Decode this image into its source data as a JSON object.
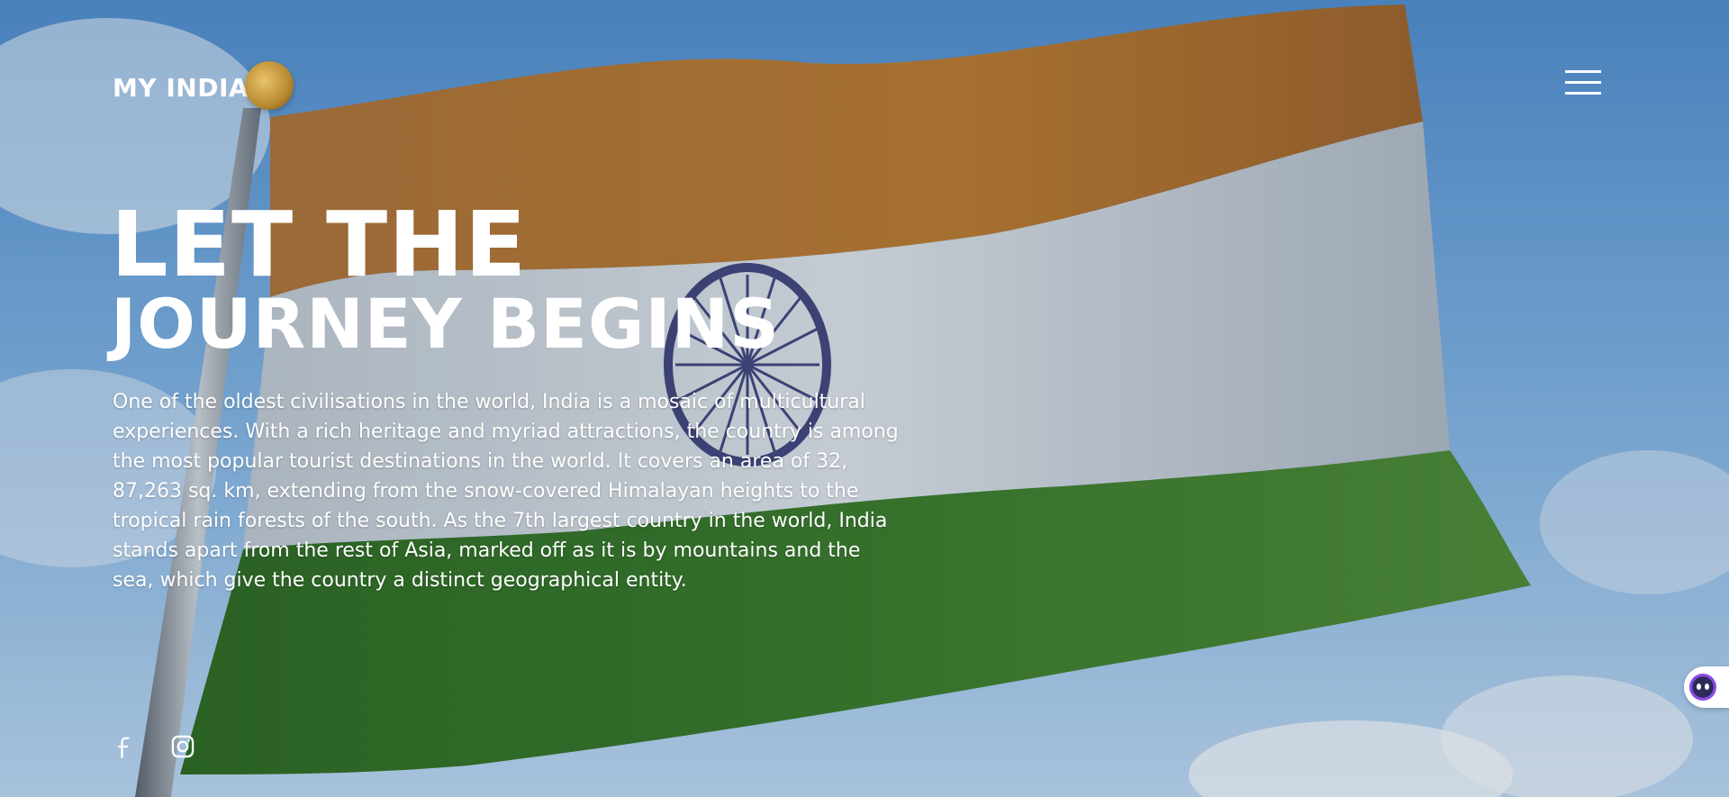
{
  "brand": {
    "name": "MY INDIA"
  },
  "hero": {
    "title_line1": "LET THE",
    "title_line2": "JOURNEY BEGINS",
    "description": "One of the oldest civilisations in the world, India is a mosaic of multicultural experiences. With a rich heritage and myriad attractions, the country is among the most popular tourist destinations in the world. It covers an area of 32, 87,263 sq. km, extending from the snow-covered Himalayan heights to the tropical rain forests of the south. As the 7th largest country in the world, India stands apart from the rest of Asia, marked off as it is by mountains and the sea, which give the country a distinct geographical entity."
  },
  "social": {
    "icons": [
      "facebook-icon",
      "instagram-icon"
    ]
  },
  "icons": {
    "menu": "hamburger-menu-icon",
    "assistant": "assistant-bot-icon"
  },
  "colors": {
    "saffron": "#b0773a",
    "white": "#c9d3dd",
    "green": "#2f6a2a",
    "chakra": "#2a2f6e",
    "sky": "#6ea3d8"
  }
}
